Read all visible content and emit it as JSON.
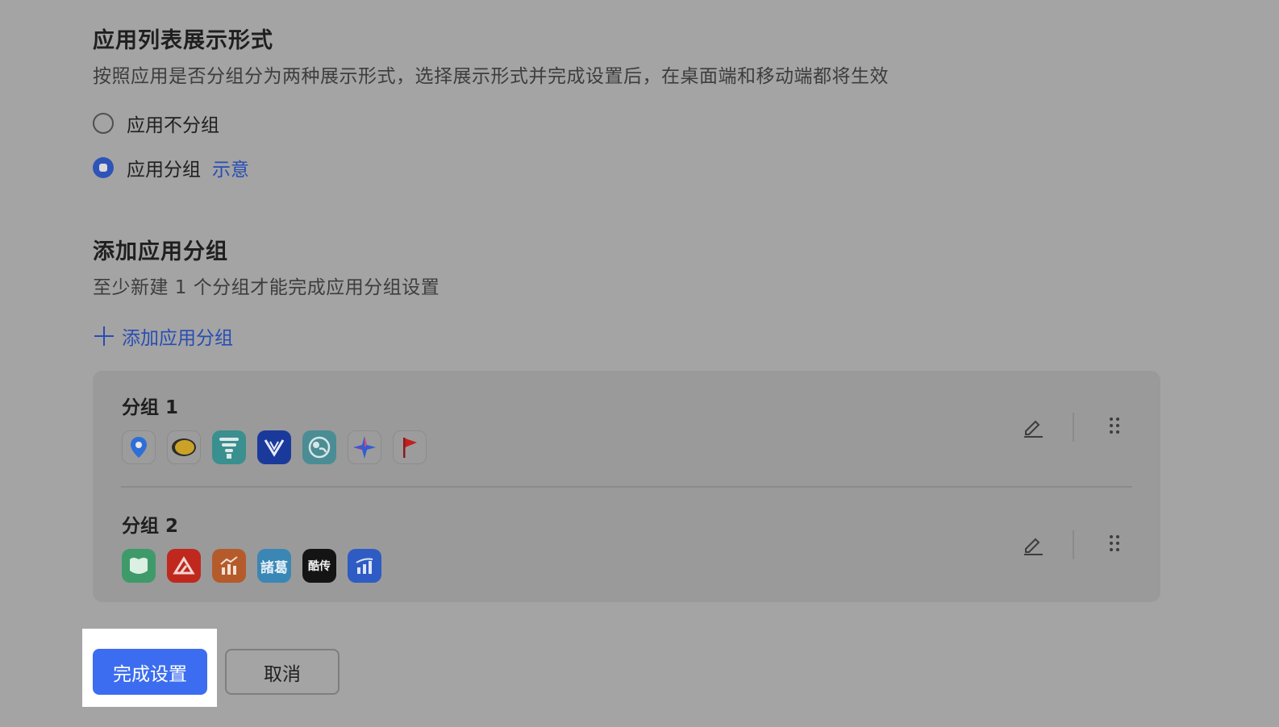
{
  "section1": {
    "title": "应用列表展示形式",
    "desc": "按照应用是否分组分为两种展示形式，选择展示形式并完成设置后，在桌面端和移动端都将生效",
    "options": [
      {
        "label": "应用不分组",
        "selected": false
      },
      {
        "label": "应用分组",
        "selected": true,
        "extra_link": "示意"
      }
    ]
  },
  "section2": {
    "title": "添加应用分组",
    "desc": "至少新建 1 个分组才能完成应用分组设置",
    "add_label": "添加应用分组"
  },
  "groups": [
    {
      "name": "分组 1",
      "apps": [
        "location-pin-icon",
        "yellow-oval-icon",
        "teal-tower-icon",
        "blue-v-icon",
        "teal-globe-icon",
        "star-spark-icon",
        "red-flag-icon"
      ]
    },
    {
      "name": "分组 2",
      "apps": [
        "green-leaf-icon",
        "red-triangle-icon",
        "orange-chart-icon",
        "blue-zhuge-icon",
        "black-kuchuan-icon",
        "blue-bars-icon"
      ],
      "app_texts": {
        "blue-zhuge-icon": "諸葛",
        "black-kuchuan-icon": "酷传"
      }
    }
  ],
  "footer": {
    "confirm_label": "完成设置",
    "cancel_label": "取消"
  },
  "colors": {
    "accent": "#3c6df0",
    "link": "#274db4",
    "overlay_bg": "#a4a4a4"
  }
}
